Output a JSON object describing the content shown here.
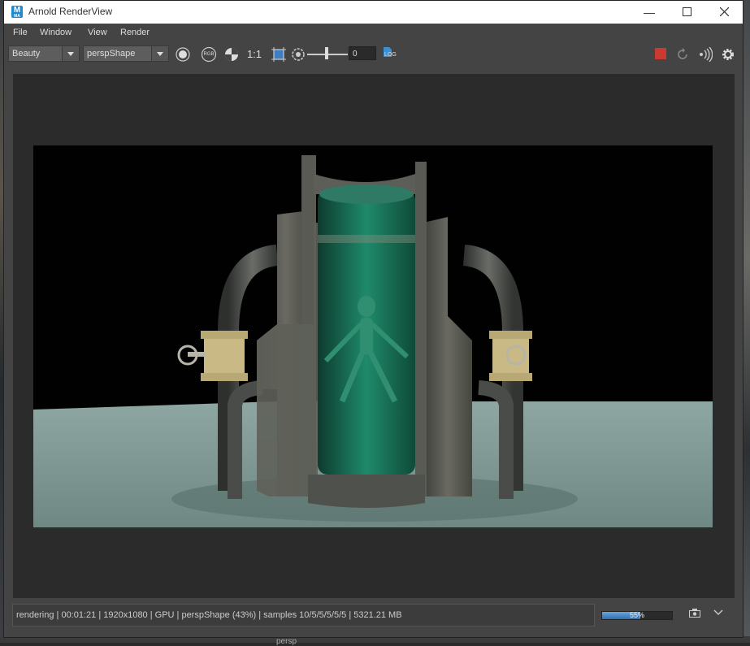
{
  "window": {
    "title": "Arnold RenderView",
    "app_icon_letter": "M",
    "app_icon_sub": "MA"
  },
  "menubar": {
    "items": [
      "File",
      "Window",
      "View",
      "Render"
    ]
  },
  "toolbar": {
    "aov_value": "Beauty",
    "camera_value": "perspShape",
    "ratio_label": "1:1",
    "rgb_label": "RGB",
    "exposure_value": "0",
    "log_label": "LOG",
    "stop_color": "#c73b33"
  },
  "status": {
    "text": "rendering | 00:01:21 |  1920x1080 | GPU | perspShape (43%) | samples 10/5/5/5/5/5 | 5321.21 MB",
    "progress_label": "55%",
    "progress": 0.55,
    "progress_color": "#3f85c8"
  },
  "background": {
    "bottom_label": "persp"
  }
}
